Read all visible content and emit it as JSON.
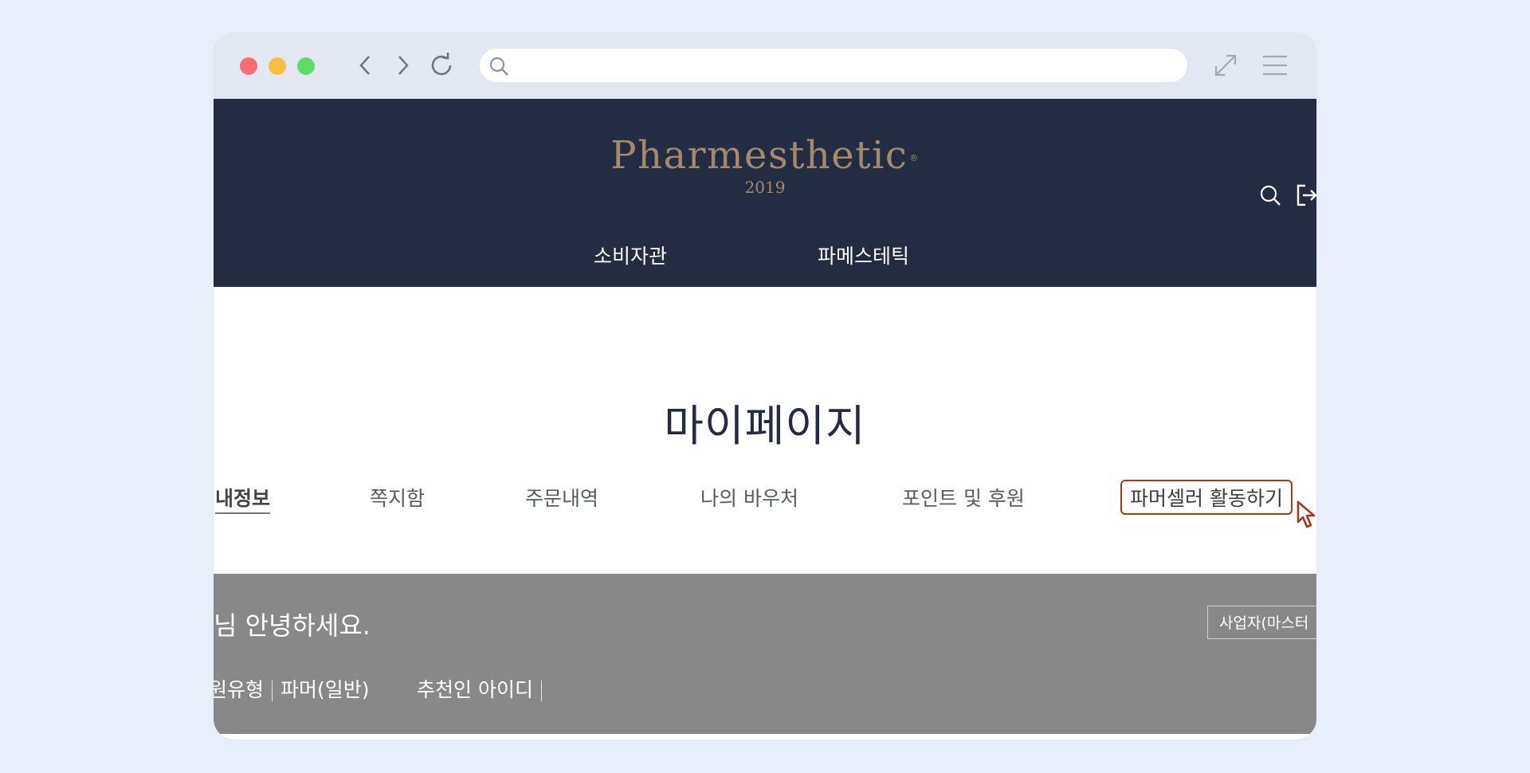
{
  "browser": {
    "url_placeholder": "",
    "icons": [
      "back-icon",
      "forward-icon",
      "reload-icon",
      "search-icon",
      "expand-icon",
      "menu-icon"
    ]
  },
  "site": {
    "logo_name": "Pharmesthetic",
    "logo_reg": "®",
    "logo_year": "2019",
    "top_nav": [
      "소비자관",
      "파메스테틱"
    ]
  },
  "page": {
    "title": "마이페이지",
    "tabs": [
      {
        "label": "내정보",
        "active": true
      },
      {
        "label": "쪽지함"
      },
      {
        "label": "주문내역"
      },
      {
        "label": "나의 바우처"
      },
      {
        "label": "포인트 및 후원"
      },
      {
        "label": "파머셀러 활동하기",
        "highlighted": true
      }
    ]
  },
  "profile": {
    "greeting": "님 안녕하세요.",
    "member_badge": "사업자(마스터",
    "member_type_label": "원유형",
    "member_type_value": "파머(일반)",
    "referrer_label": "추천인 아이디"
  },
  "colors": {
    "header_bg": "#242c42",
    "logo": "#a48a6c",
    "panel_bg": "#888888",
    "highlight_border": "#a33a1c"
  }
}
